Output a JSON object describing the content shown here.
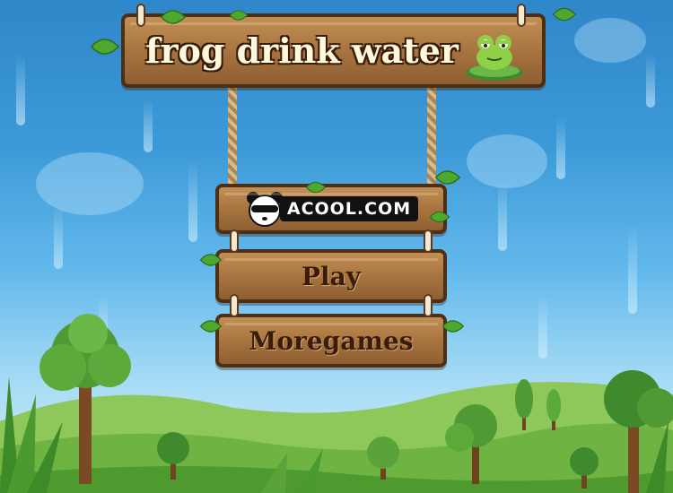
{
  "game": {
    "title": "frog drink water",
    "menu": {
      "sponsor_label": "ACOOL.COM",
      "play_label": "Play",
      "moregames_label": "Moregames"
    }
  },
  "icons": {
    "title_mascot": "frog-on-lilypad-icon",
    "sponsor_mascot": "panda-icon"
  },
  "colors": {
    "sky_top": "#2f87c9",
    "wood": "#a5723f",
    "wood_border": "#4e2e14",
    "title_text": "#fff8dc",
    "button_text": "#3a1d08"
  }
}
